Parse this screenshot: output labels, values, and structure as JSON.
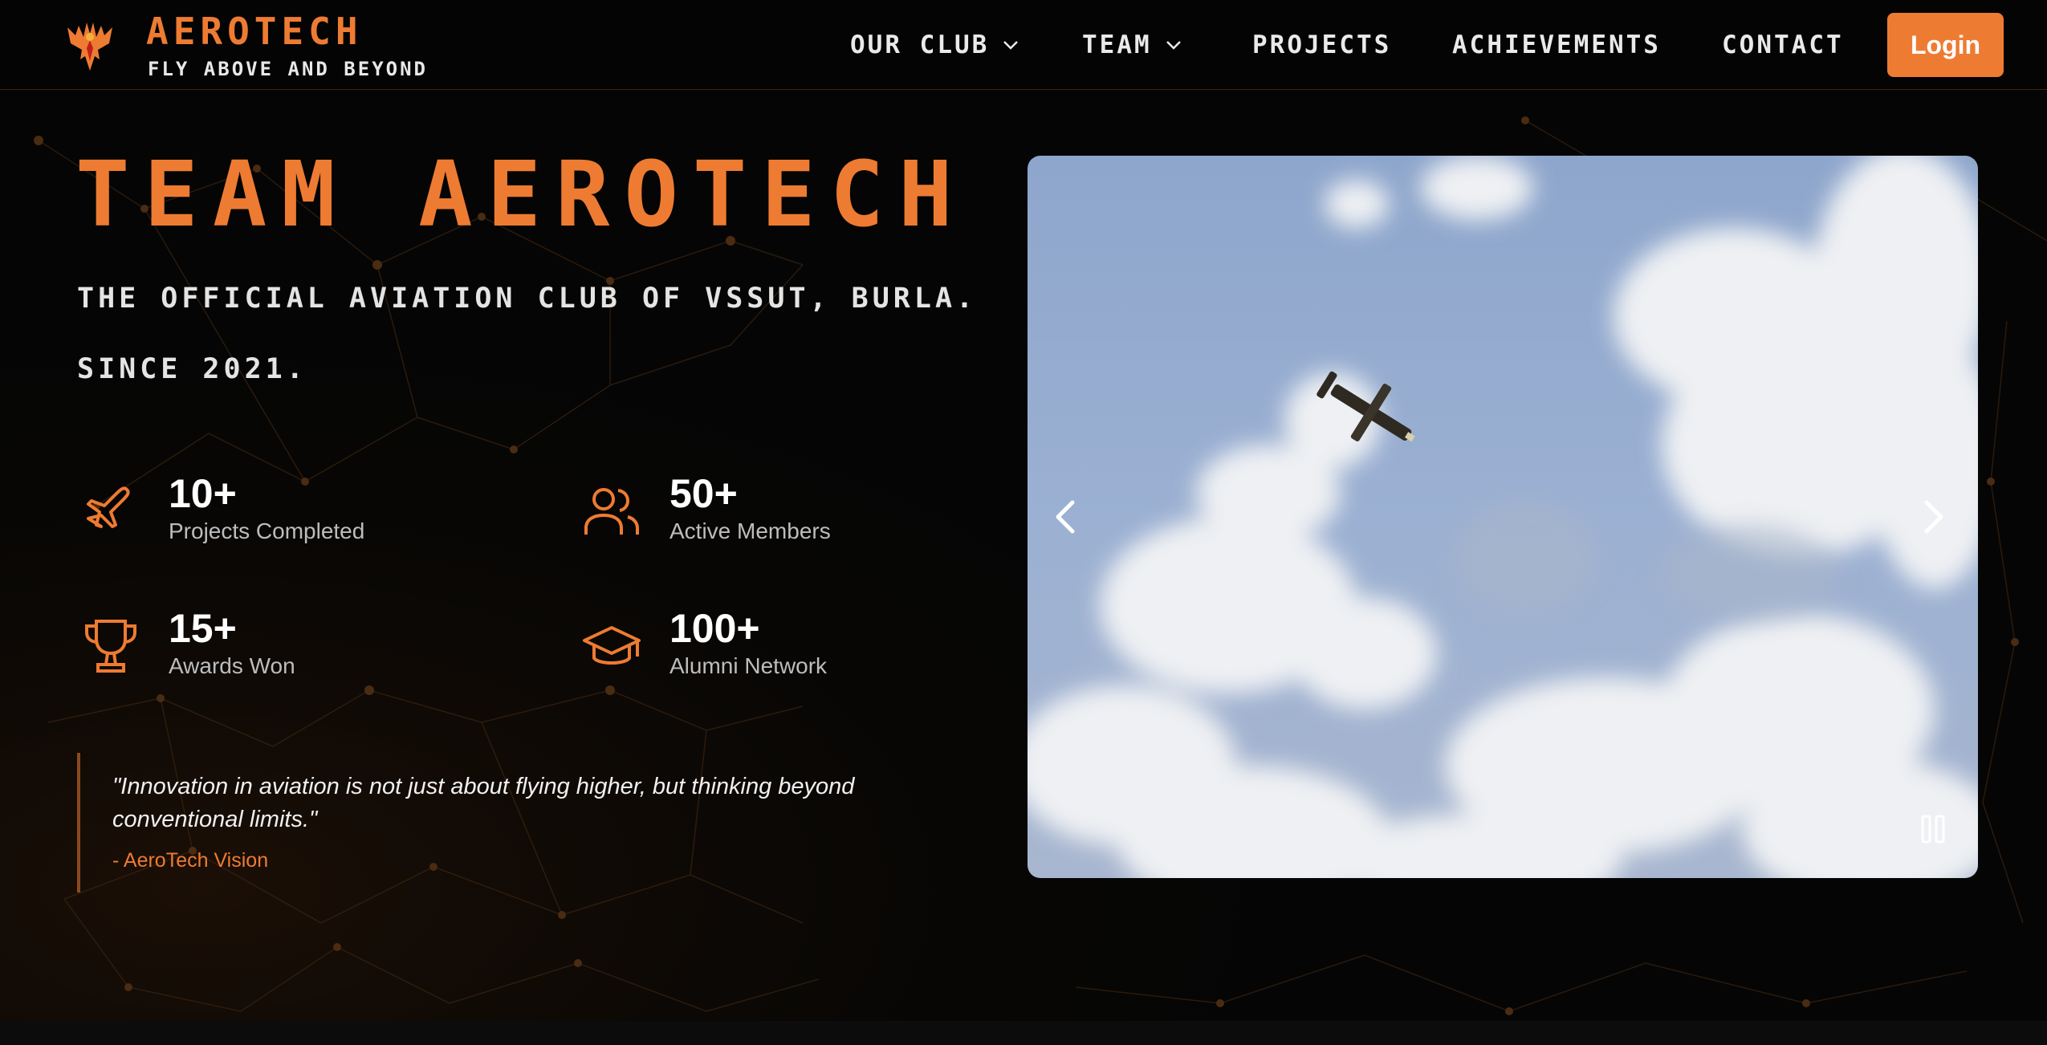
{
  "brand": {
    "name": "AEROTECH",
    "tagline": "FLY ABOVE AND BEYOND",
    "logo_icon": "phoenix-logo"
  },
  "nav": {
    "items": [
      {
        "label": "OUR CLUB",
        "dropdown": true
      },
      {
        "label": "TEAM",
        "dropdown": true
      },
      {
        "label": "PROJECTS",
        "dropdown": false
      },
      {
        "label": "ACHIEVEMENTS",
        "dropdown": false
      },
      {
        "label": "CONTACT",
        "dropdown": false
      }
    ],
    "login_label": "Login"
  },
  "hero": {
    "title": "TEAM AEROTECH",
    "subtitle_line1": "THE OFFICIAL AVIATION CLUB OF VSSUT, BURLA.",
    "subtitle_line2": "SINCE 2021."
  },
  "stats": [
    {
      "value": "10+",
      "label": "Projects Completed",
      "icon": "airplane-icon"
    },
    {
      "value": "50+",
      "label": "Active Members",
      "icon": "users-icon"
    },
    {
      "value": "15+",
      "label": "Awards Won",
      "icon": "trophy-icon"
    },
    {
      "value": "100+",
      "label": "Alumni Network",
      "icon": "graduation-cap-icon"
    }
  ],
  "quote": {
    "text": "\"Innovation in aviation is not just about flying higher, but thinking beyond conventional limits.\"",
    "author": "- AeroTech Vision"
  },
  "carousel": {
    "image": "rc-plane-flying-in-cloudy-sky",
    "controls": [
      "chevron-left-icon",
      "chevron-right-icon",
      "pause-icon"
    ]
  },
  "colors": {
    "accent": "#ee7b32",
    "background": "#050505",
    "text": "#eaeaea",
    "muted": "#bdbdbd"
  }
}
